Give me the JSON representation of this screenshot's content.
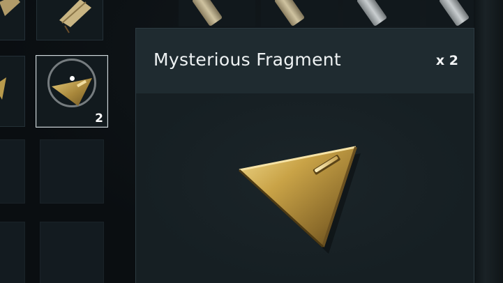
{
  "item_detail": {
    "name": "Mysterious Fragment",
    "quantity": "x 2"
  },
  "inventory": {
    "selected_slot": {
      "count": "2",
      "icon": "triangle-fragment-icon"
    }
  },
  "colors": {
    "gold": "#c9a347",
    "panel_bg": "#1a2428",
    "header_bg": "#1f2b30"
  }
}
